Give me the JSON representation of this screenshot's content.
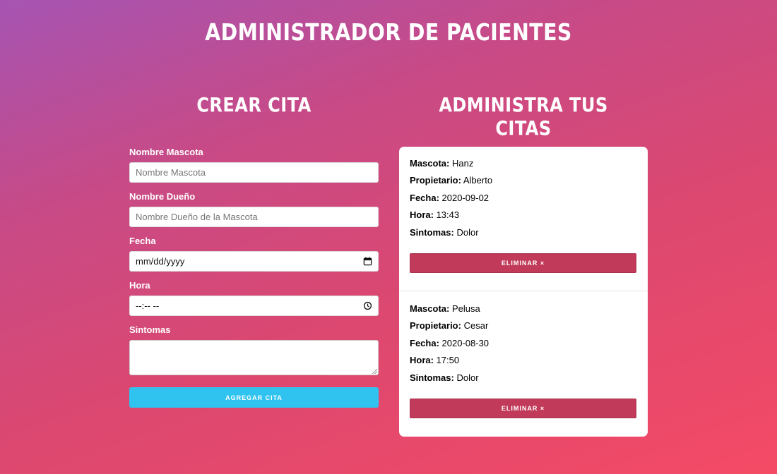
{
  "app_title": "ADMINISTRADOR DE PACIENTES",
  "form": {
    "title": "CREAR CITA",
    "fields": [
      {
        "label": "Nombre Mascota",
        "placeholder": "Nombre Mascota",
        "value": ""
      },
      {
        "label": "Nombre Dueño",
        "placeholder": "Nombre Dueño de la Mascota",
        "value": ""
      },
      {
        "label": "Fecha",
        "placeholder": "mm/dd/yyyy",
        "value": "",
        "icon": "calendar-icon"
      },
      {
        "label": "Hora",
        "placeholder": "--:-- --",
        "value": "",
        "icon": "clock-icon"
      },
      {
        "label": "Sintomas",
        "placeholder": "",
        "value": ""
      }
    ],
    "submit_label": "AGREGAR CITA",
    "submit_color": "#30c3ef"
  },
  "citas": {
    "title": "ADMINISTRA TUS CITAS",
    "items": [
      {
        "mascota_label": "Mascota:",
        "mascota": "Hanz",
        "propietario_label": "Propietario:",
        "propietario": "Alberto",
        "fecha_label": "Fecha:",
        "fecha": "2020-09-02",
        "hora_label": "Hora:",
        "hora": "13:43",
        "sintomas_label": "Sintomas:",
        "sintomas": "Dolor",
        "delete_label": "ELIMINAR ×"
      },
      {
        "mascota_label": "Mascota:",
        "mascota": "Pelusa",
        "propietario_label": "Propietario:",
        "propietario": "Cesar",
        "fecha_label": "Fecha:",
        "fecha": "2020-08-30",
        "hora_label": "Hora:",
        "hora": "17:50",
        "sintomas_label": "Sintomas:",
        "sintomas": "Dolor",
        "delete_label": "ELIMINAR ×"
      }
    ],
    "delete_color": "#c23a5a"
  }
}
